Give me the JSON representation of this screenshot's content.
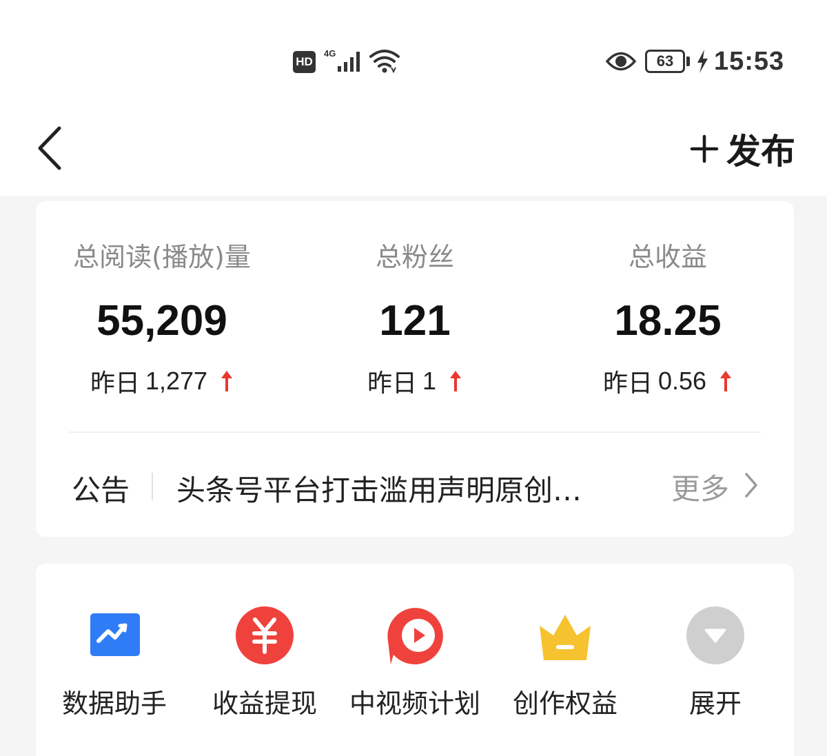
{
  "status_bar": {
    "hd": "HD",
    "network": "4G",
    "battery": "63",
    "time": "15:53"
  },
  "nav": {
    "publish_label": "发布"
  },
  "stats": [
    {
      "title": "总阅读(播放)量",
      "value": "55,209",
      "yesterday_label": "昨日",
      "yesterday_value": "1,277"
    },
    {
      "title": "总粉丝",
      "value": "121",
      "yesterday_label": "昨日",
      "yesterday_value": "1"
    },
    {
      "title": "总收益",
      "value": "18.25",
      "yesterday_label": "昨日",
      "yesterday_value": "0.56"
    }
  ],
  "notice": {
    "tag": "公告",
    "text": "头条号平台打击滥用声明原创…",
    "more": "更多"
  },
  "tools": [
    {
      "label": "数据助手",
      "icon": "chart-trend-icon"
    },
    {
      "label": "收益提现",
      "icon": "yuan-icon"
    },
    {
      "label": "中视频计划",
      "icon": "video-play-icon"
    },
    {
      "label": "创作权益",
      "icon": "crown-icon"
    },
    {
      "label": "展开",
      "icon": "expand-icon"
    }
  ],
  "colors": {
    "accent_up": "#e8382f",
    "blue": "#2f7cf6",
    "red": "#f0423c",
    "gold": "#f6c22f",
    "gray_icon": "#cfcfcf"
  }
}
